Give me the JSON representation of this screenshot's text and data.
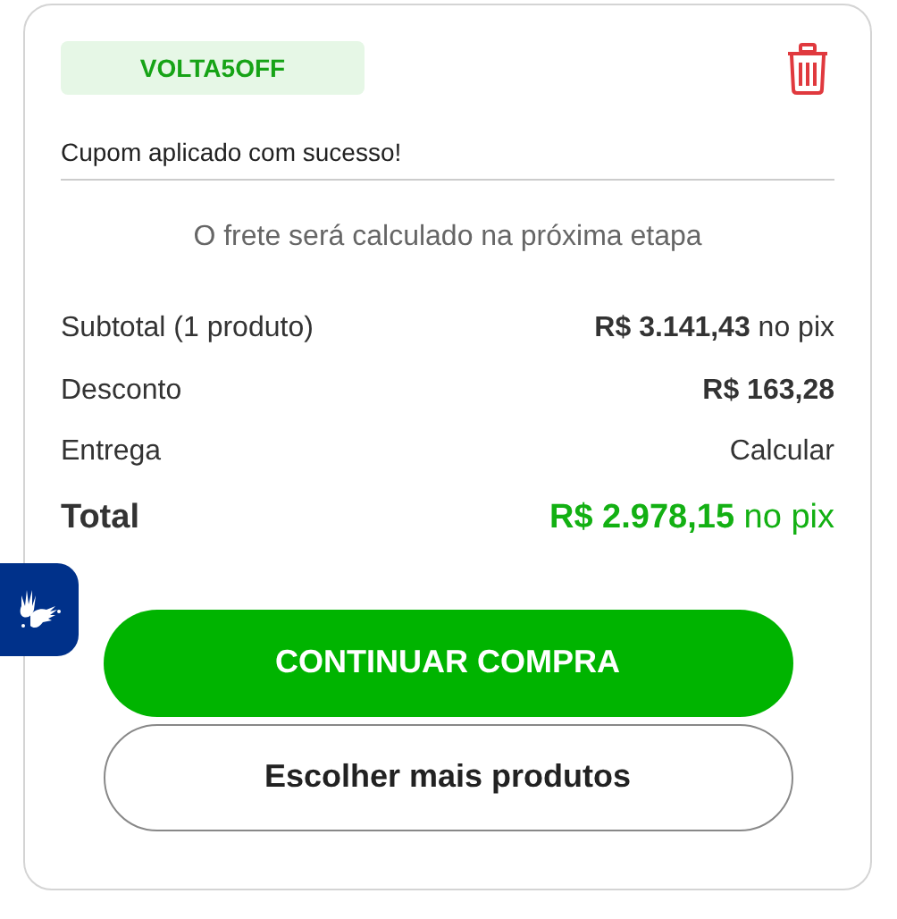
{
  "coupon": {
    "code": "VOLTA5OFF",
    "message": "Cupom aplicado com sucesso!"
  },
  "shipping_note": "O frete será calculado na próxima etapa",
  "summary": [
    {
      "kind": "line",
      "label": "Subtotal (1 produto)",
      "value": "**R$ 3.141,43** no pix"
    },
    {
      "kind": "line",
      "label": "Desconto",
      "value": "**R$ 163,28**"
    },
    {
      "kind": "line",
      "label": "Entrega",
      "value": "Calcular"
    },
    {
      "kind": "total",
      "label": "Total",
      "value": "**R$ 2.978,15** no pix"
    }
  ],
  "buttons": [
    {
      "kind": "primary",
      "label": "CONTINUAR COMPRA"
    },
    {
      "kind": "outline",
      "label": "Escolher mais produtos"
    }
  ]
}
